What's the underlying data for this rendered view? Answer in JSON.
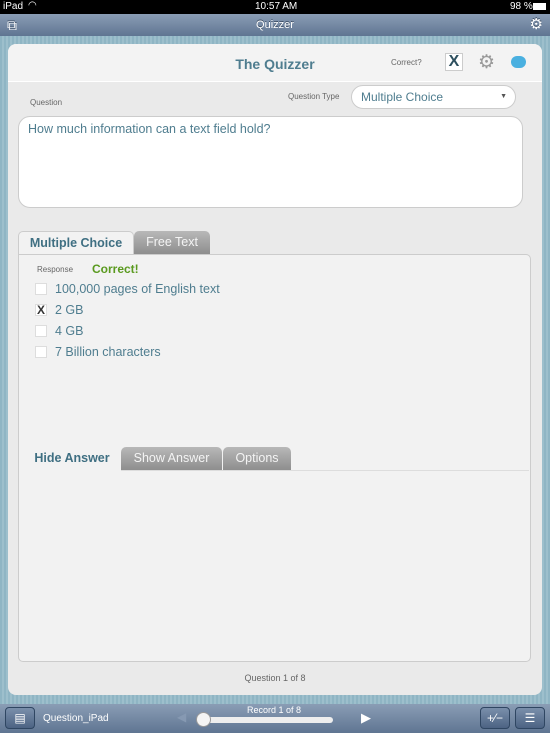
{
  "status": {
    "device": "iPad",
    "time": "10:57 AM",
    "battery": "98 %"
  },
  "nav": {
    "title": "Quizzer"
  },
  "header": {
    "title": "The Quizzer",
    "correct_label": "Correct?",
    "correct_value": "X"
  },
  "question": {
    "label": "Question",
    "type_label": "Question Type",
    "type_value": "Multiple Choice",
    "text": "How much information can a text field hold?"
  },
  "tabs": [
    {
      "label": "Multiple Choice",
      "active": true
    },
    {
      "label": "Free Text",
      "active": false
    }
  ],
  "response": {
    "label": "Response",
    "result": "Correct!",
    "result_color": "#5a9a1f"
  },
  "options": [
    {
      "label": "100,000 pages of English text",
      "checked": false
    },
    {
      "label": "2 GB",
      "checked": true,
      "mark": "X"
    },
    {
      "label": "4 GB",
      "checked": false
    },
    {
      "label": "7 Billion characters",
      "checked": false
    }
  ],
  "answer_tabs": [
    {
      "label": "Hide Answer",
      "active": true
    },
    {
      "label": "Show Answer",
      "active": false
    },
    {
      "label": "Options",
      "active": false
    }
  ],
  "footer": {
    "question_counter": "Question 1 of 8"
  },
  "toolbar": {
    "layout_name": "Question_iPad",
    "record": "Record 1 of 8",
    "slider_value": 0.0
  }
}
